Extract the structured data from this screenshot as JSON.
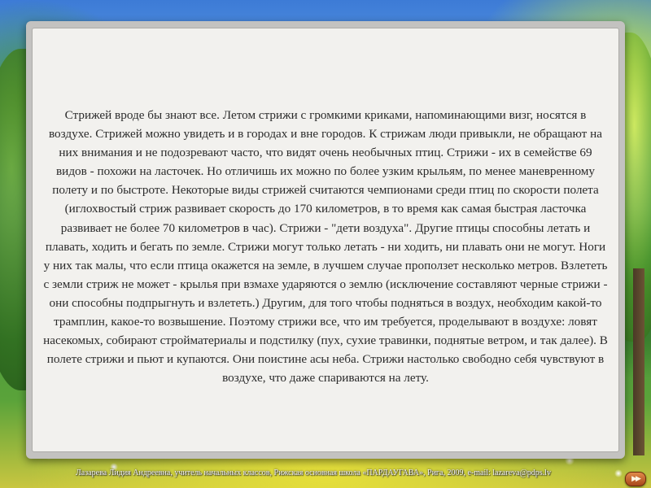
{
  "slide": {
    "text": "Стрижей вроде бы знают все. Летом стрижи с громкими криками, напоминающими визг, носятся в воздухе. Стрижей можно увидеть и в городах и вне городов. К стрижам люди привыкли, не обращают на них внимания и не подозревают часто, что видят очень необычных птиц. Стрижи - их в семействе 69 видов - похожи на ласточек. Но отличишь их можно по более узким крыльям, по менее маневренному полету и по быстроте. Некоторые виды стрижей считаются чемпионами среди птиц по скорости полета (иглохвостый стриж развивает скорость до 170 километров, в то время как самая быстрая ласточка развивает не более 70 километров в час). Стрижи - \"дети воздуха\". Другие птицы способны летать и плавать, ходить и бегать по земле. Стрижи могут только летать - ни ходить, ни плавать они не могут. Ноги у них так малы, что если птица окажется на земле, в лучшем случае проползет несколько метров. Взлететь с земли стриж не может - крылья при взмахе ударяются о землю (исключение составляют черные стрижи - они способны подпрыгнуть и взлететь.) Другим, для того чтобы подняться в воздух, необходим какой-то трамплин, какое-то возвышение. Поэтому стрижи все, что им требуется, проделывают в воздухе: ловят насекомых, собирают стройматериалы и подстилку (пух, сухие травинки, поднятые ветром, и так далее). В полете стрижи и пьют и купаются. Они поистине асы неба. Стрижи настолько свободно себя чувствуют в воздухе, что даже спариваются на лету."
  },
  "footer": {
    "text": "Лазарева Лидия Андреевна, учитель начальных классов, Рижская основная школа «ПАРДАУГАВА», Рига, 2009, e-mail: lazareva@pdps.lv"
  },
  "nav": {
    "next_icon": "double-chevron-right-icon",
    "next_glyph": "▶▶"
  },
  "colors": {
    "text": "#2b2b2b",
    "frame": "#c3c2c0",
    "paper": "#f2f1ee",
    "nav_button": "#c0622e"
  }
}
